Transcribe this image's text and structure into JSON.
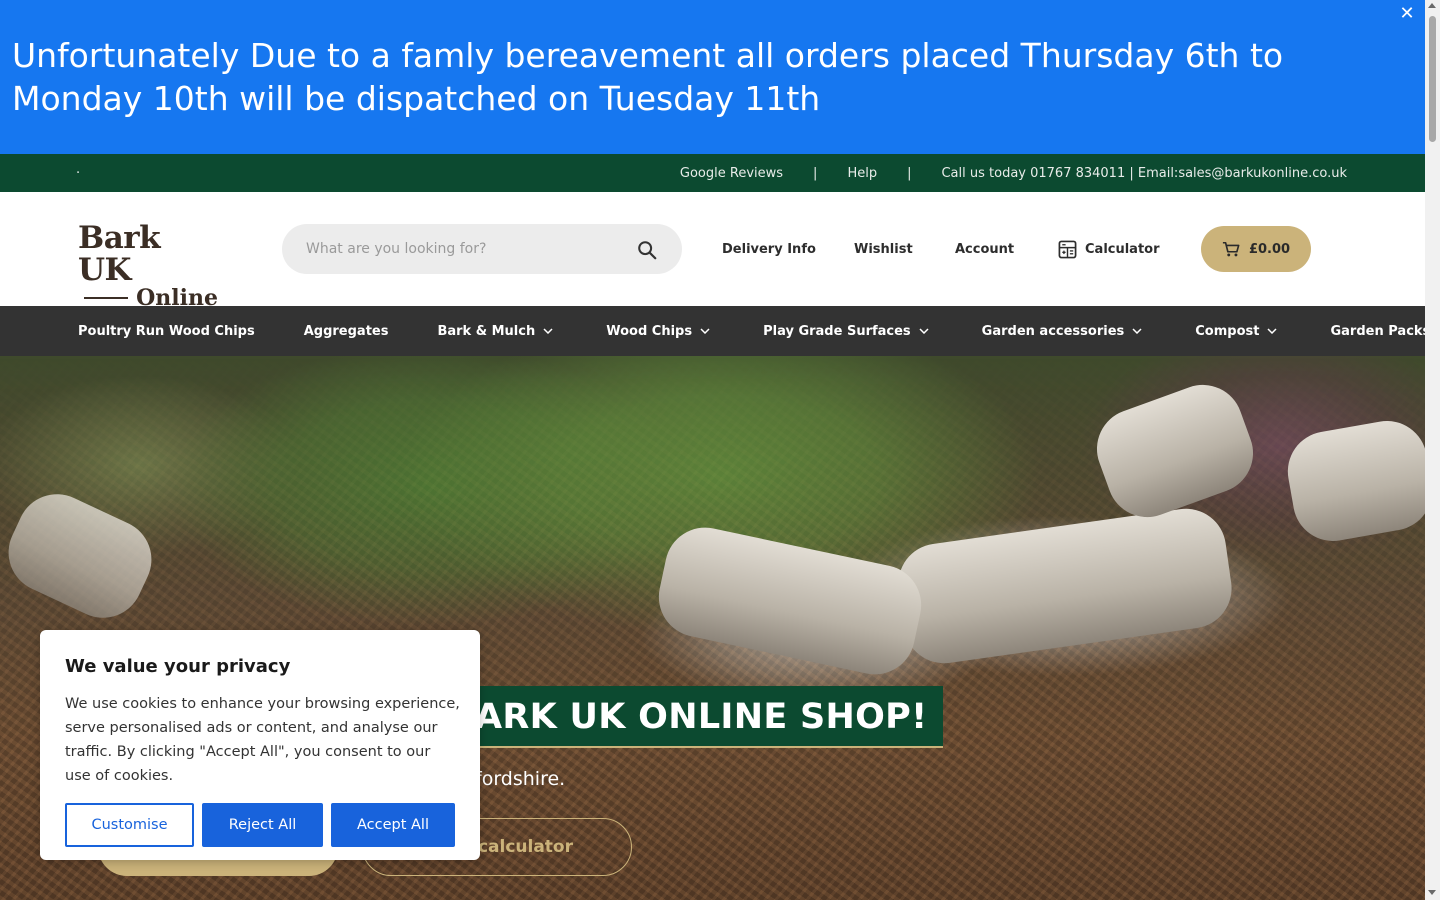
{
  "announcement": {
    "text": "Unfortunately Due to a famly bereavement all orders placed Thursday 6th to Monday 10th will be dispatched on Tuesday 11th",
    "close_glyph": "✕"
  },
  "topbar": {
    "dot": ".",
    "google_reviews": "Google Reviews",
    "separator": "|",
    "help": "Help",
    "contact": "Call us today 01767 834011 | Email:sales@barkukonline.co.uk"
  },
  "header": {
    "logo_top": "Bark UK",
    "logo_bottom": "Online",
    "search_placeholder": "What are you looking for?",
    "delivery": "Delivery Info",
    "wishlist": "Wishlist",
    "account": "Account",
    "calculator": "Calculator",
    "cart_total": "£0.00"
  },
  "nav": {
    "items": [
      {
        "label": "Poultry Run Wood Chips",
        "dropdown": false
      },
      {
        "label": "Aggregates",
        "dropdown": false
      },
      {
        "label": "Bark & Mulch",
        "dropdown": true
      },
      {
        "label": "Wood Chips",
        "dropdown": true
      },
      {
        "label": "Play Grade Surfaces",
        "dropdown": true
      },
      {
        "label": "Garden accessories",
        "dropdown": true
      },
      {
        "label": "Compost",
        "dropdown": true
      },
      {
        "label": "Garden Packs",
        "dropdown": true
      }
    ]
  },
  "hero": {
    "heading": "ARK UK ONLINE SHOP!",
    "subtitle": "fordshire.",
    "secondary_button": "calculator"
  },
  "cookie": {
    "title": "We value your privacy",
    "body": "We use cookies to enhance your browsing experience, serve personalised ads or content, and analyse our traffic. By clicking \"Accept All\", you consent to our use of cookies.",
    "customise": "Customise",
    "reject": "Reject All",
    "accept": "Accept All"
  },
  "colors": {
    "announcement_bg": "#1677f0",
    "brand_green": "#0c4a30",
    "gold": "#cbb37a",
    "nav_bg": "#333333",
    "cookie_blue": "#1863dc"
  }
}
